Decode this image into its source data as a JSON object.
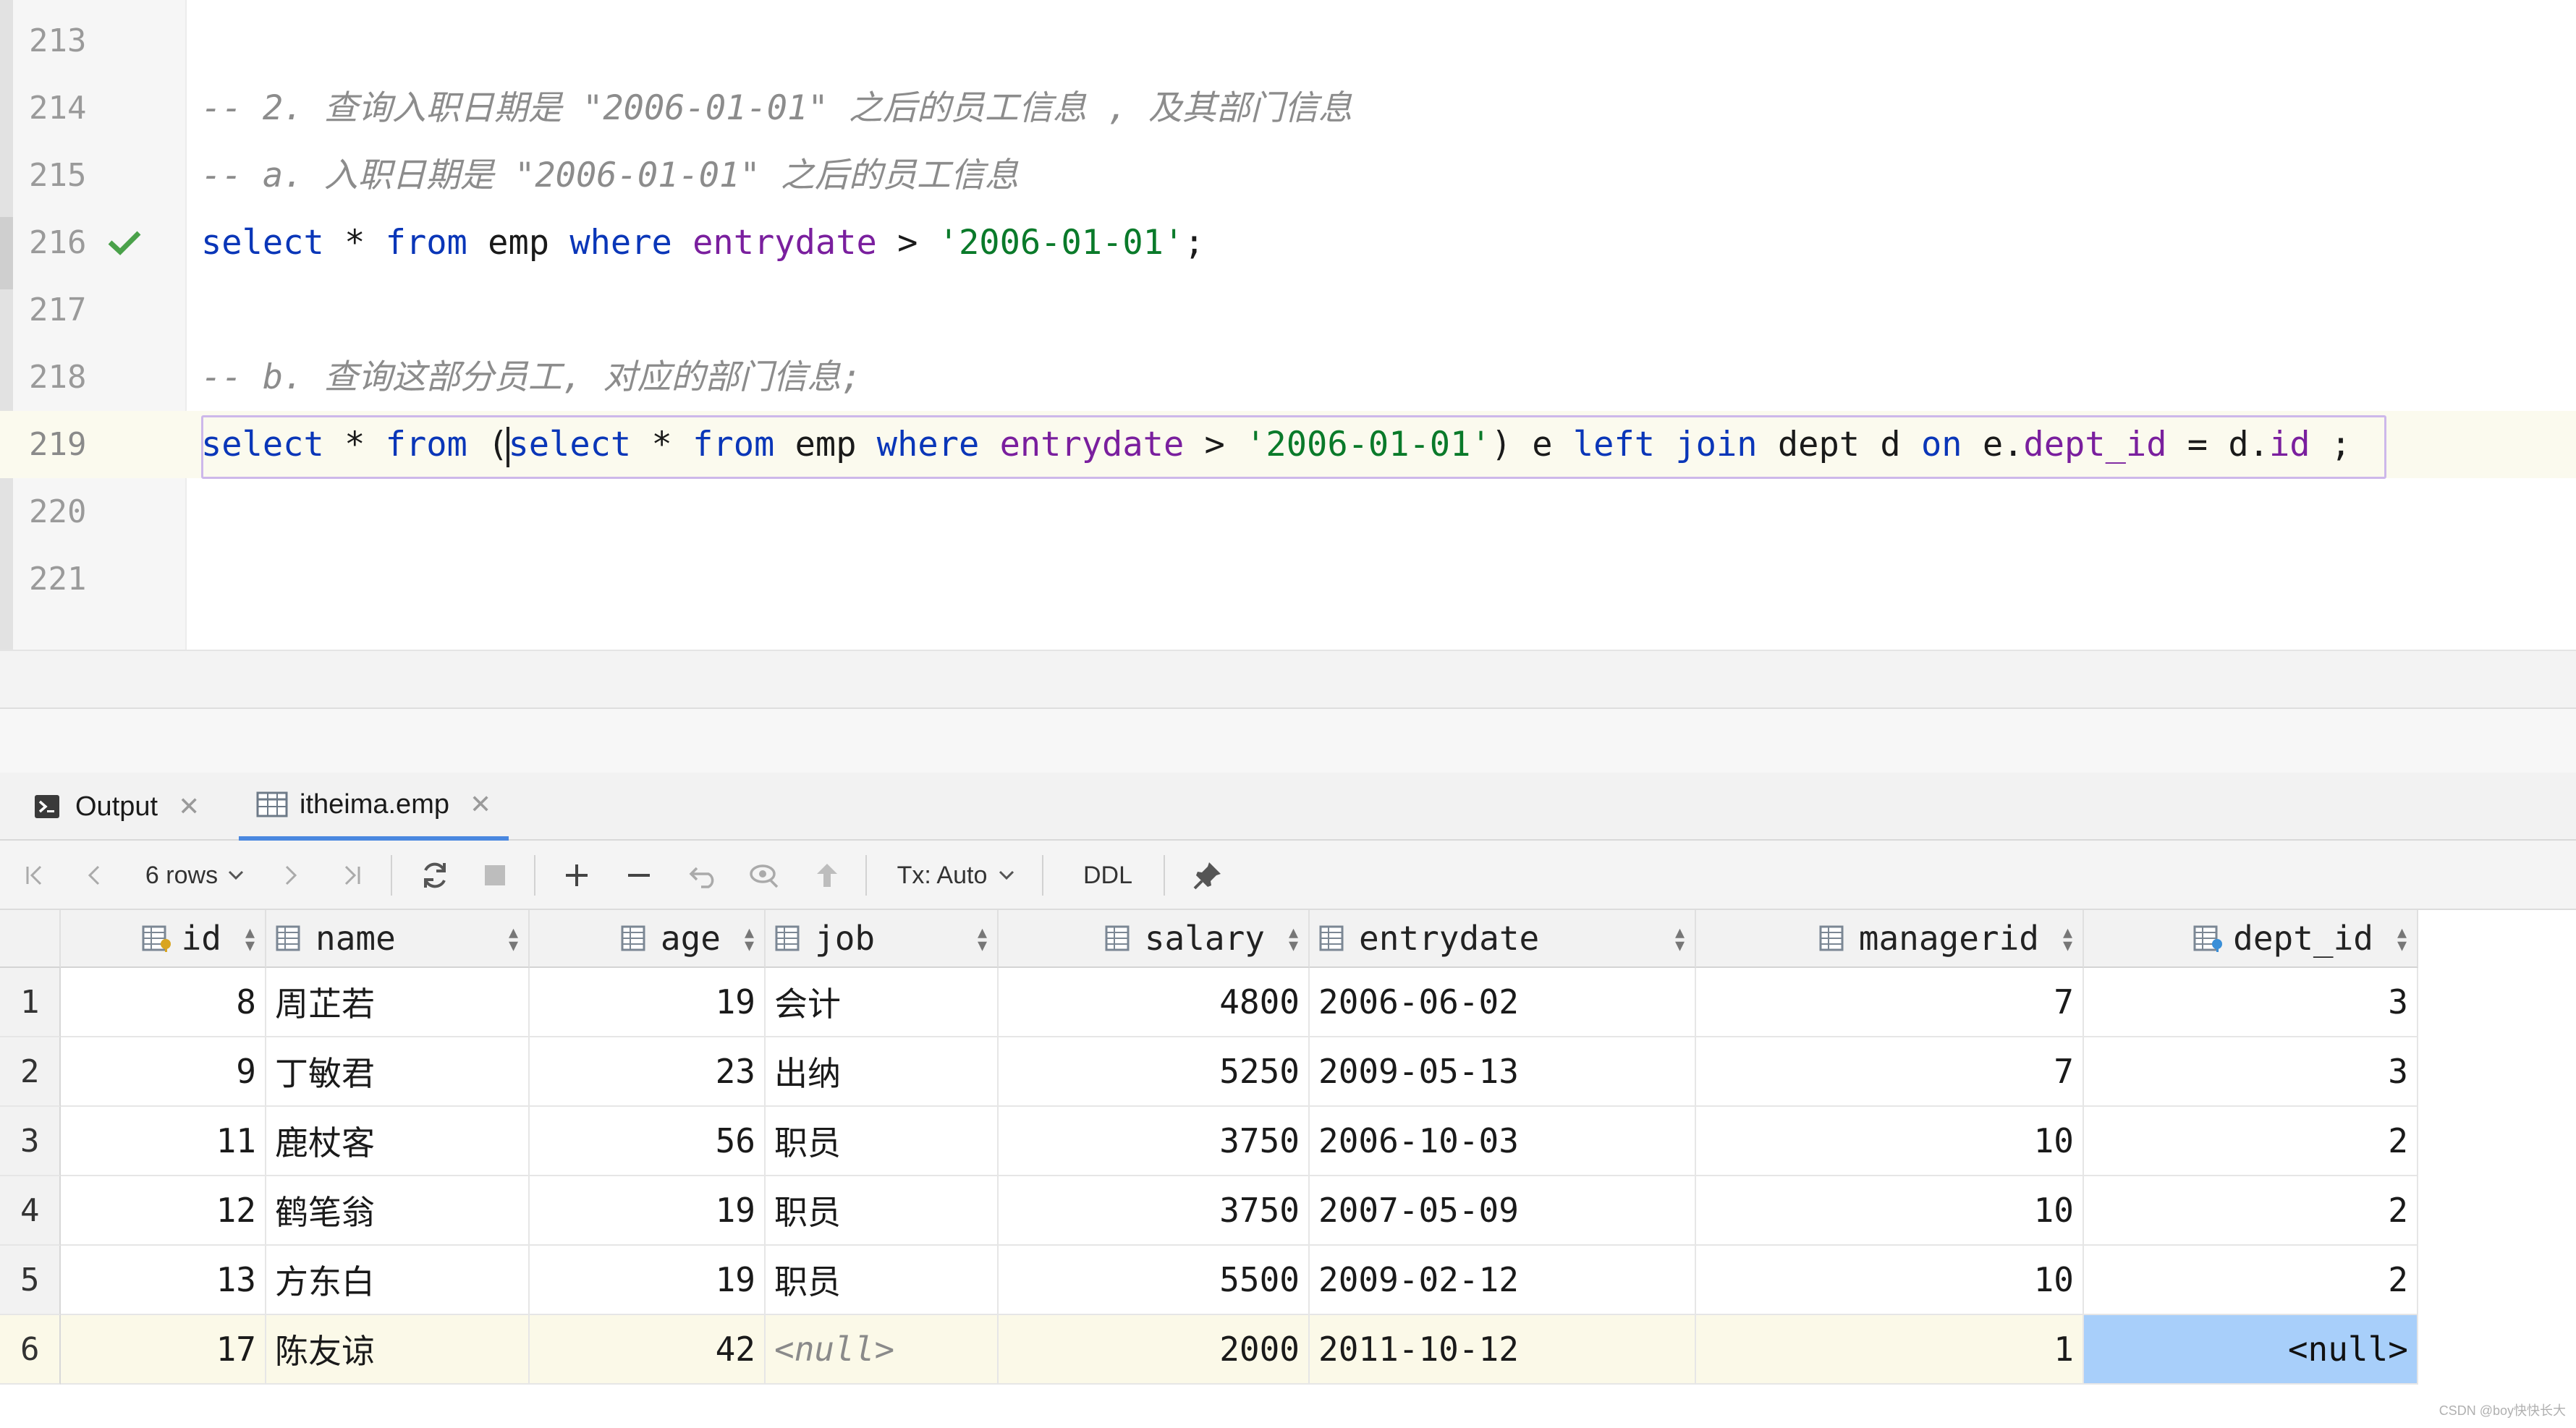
{
  "editor": {
    "lines": [
      {
        "num": "213",
        "code": []
      },
      {
        "num": "214",
        "code": [
          {
            "t": "cm",
            "v": "-- 2. 查询入职日期是 \"2006-01-01\" 之后的员工信息 , 及其部门信息"
          }
        ]
      },
      {
        "num": "215",
        "code": [
          {
            "t": "cm",
            "v": "-- a. 入职日期是 \"2006-01-01\" 之后的员工信息"
          }
        ]
      },
      {
        "num": "216",
        "check": true,
        "code": [
          {
            "t": "kw",
            "v": "select"
          },
          {
            "t": "op",
            "v": " * "
          },
          {
            "t": "kw",
            "v": "from"
          },
          {
            "t": "op",
            "v": " emp "
          },
          {
            "t": "kw",
            "v": "where"
          },
          {
            "t": "op",
            "v": " "
          },
          {
            "t": "fn",
            "v": "entrydate"
          },
          {
            "t": "op",
            "v": " > "
          },
          {
            "t": "str",
            "v": "'2006-01-01'"
          },
          {
            "t": "op",
            "v": ";"
          }
        ]
      },
      {
        "num": "217",
        "code": []
      },
      {
        "num": "218",
        "code": [
          {
            "t": "cm",
            "v": "-- b. 查询这部分员工, 对应的部门信息;"
          }
        ]
      },
      {
        "num": "219",
        "current": true,
        "code": [
          {
            "t": "kw",
            "v": "select"
          },
          {
            "t": "op",
            "v": " * "
          },
          {
            "t": "kw",
            "v": "from"
          },
          {
            "t": "op",
            "v": " ("
          },
          {
            "t": "kw",
            "v": "select"
          },
          {
            "t": "op",
            "v": " * "
          },
          {
            "t": "kw",
            "v": "from"
          },
          {
            "t": "op",
            "v": " emp "
          },
          {
            "t": "kw",
            "v": "where"
          },
          {
            "t": "op",
            "v": " "
          },
          {
            "t": "fn",
            "v": "entrydate"
          },
          {
            "t": "op",
            "v": " > "
          },
          {
            "t": "str",
            "v": "'2006-01-01'"
          },
          {
            "t": "op",
            "v": ") e "
          },
          {
            "t": "kw",
            "v": "left join"
          },
          {
            "t": "op",
            "v": " dept d "
          },
          {
            "t": "kw",
            "v": "on"
          },
          {
            "t": "op",
            "v": " e."
          },
          {
            "t": "fn",
            "v": "dept_id"
          },
          {
            "t": "op",
            "v": " = d."
          },
          {
            "t": "fn",
            "v": "id"
          },
          {
            "t": "op",
            "v": " ;"
          }
        ]
      },
      {
        "num": "220",
        "code": []
      },
      {
        "num": "221",
        "code": []
      }
    ]
  },
  "tabs": {
    "output_label": "Output",
    "emp_label": "itheima.emp"
  },
  "toolbar": {
    "rows_label": "6 rows",
    "tx_label": "Tx: Auto",
    "ddl_label": "DDL"
  },
  "table": {
    "columns": [
      {
        "key": "id",
        "label": "id",
        "icon": "key-column-icon"
      },
      {
        "key": "name",
        "label": "name",
        "icon": "column-icon"
      },
      {
        "key": "age",
        "label": "age",
        "icon": "column-icon"
      },
      {
        "key": "job",
        "label": "job",
        "icon": "column-icon"
      },
      {
        "key": "salary",
        "label": "salary",
        "icon": "column-icon"
      },
      {
        "key": "entrydate",
        "label": "entrydate",
        "icon": "column-icon"
      },
      {
        "key": "managerid",
        "label": "managerid",
        "icon": "column-icon"
      },
      {
        "key": "dept_id",
        "label": "dept_id",
        "icon": "foreign-key-column-icon"
      }
    ],
    "rows": [
      {
        "n": "1",
        "id": "8",
        "name": "周芷若",
        "age": "19",
        "job": "会计",
        "salary": "4800",
        "entrydate": "2006-06-02",
        "managerid": "7",
        "dept_id": "3"
      },
      {
        "n": "2",
        "id": "9",
        "name": "丁敏君",
        "age": "23",
        "job": "出纳",
        "salary": "5250",
        "entrydate": "2009-05-13",
        "managerid": "7",
        "dept_id": "3"
      },
      {
        "n": "3",
        "id": "11",
        "name": "鹿杖客",
        "age": "56",
        "job": "职员",
        "salary": "3750",
        "entrydate": "2006-10-03",
        "managerid": "10",
        "dept_id": "2"
      },
      {
        "n": "4",
        "id": "12",
        "name": "鹤笔翁",
        "age": "19",
        "job": "职员",
        "salary": "3750",
        "entrydate": "2007-05-09",
        "managerid": "10",
        "dept_id": "2"
      },
      {
        "n": "5",
        "id": "13",
        "name": "方东白",
        "age": "19",
        "job": "职员",
        "salary": "5500",
        "entrydate": "2009-02-12",
        "managerid": "10",
        "dept_id": "2"
      },
      {
        "n": "6",
        "id": "17",
        "name": "陈友谅",
        "age": "42",
        "job": "<null>",
        "salary": "2000",
        "entrydate": "2011-10-12",
        "managerid": "1",
        "dept_id": "<null>"
      }
    ]
  },
  "watermark": "CSDN @boy快快长大"
}
